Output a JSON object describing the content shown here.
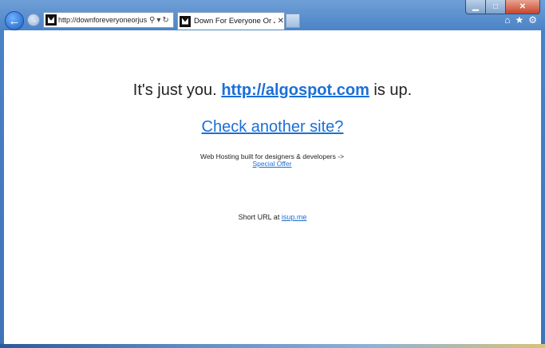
{
  "browser": {
    "address_url": "http://downforeveryoneorjus...",
    "tab_title": "Down For Everyone Or Just...",
    "window_controls": {
      "minimize": "minimize-icon",
      "maximize": "maximize-icon",
      "close": "close-icon"
    },
    "icons": [
      "back-icon",
      "forward-icon",
      "search-icon",
      "refresh-icon",
      "home-icon",
      "favorites-icon",
      "tools-icon"
    ]
  },
  "page": {
    "message_prefix": "It's just you.",
    "site_link": "http://algospot.com",
    "message_suffix": "is up.",
    "check_link": "Check another site?",
    "hosting_text": "Web Hosting built for designers & developers ->",
    "hosting_link": "Special Offer",
    "short_prefix": "Short URL at",
    "short_link": "isup.me"
  }
}
